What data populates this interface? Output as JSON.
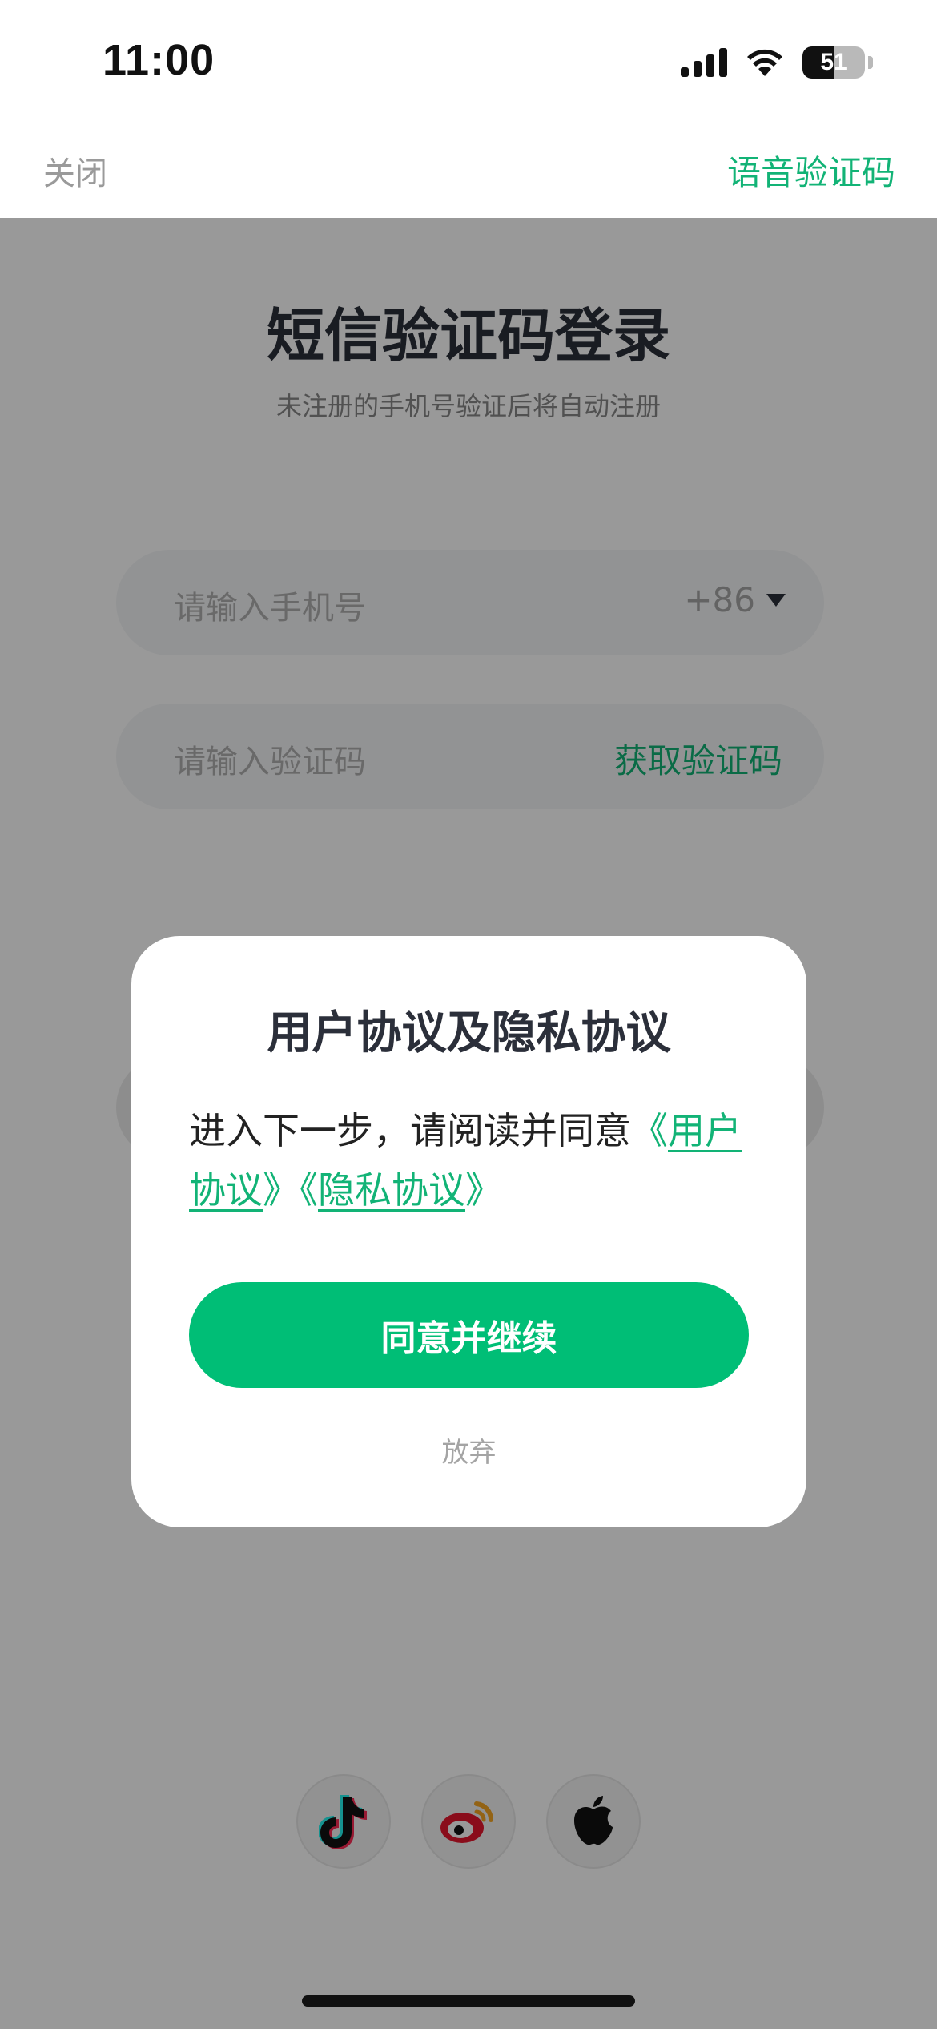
{
  "status_bar": {
    "time": "11:00",
    "battery_level": "51",
    "battery_fraction": 0.51
  },
  "nav": {
    "close_label": "关闭",
    "voice_code_label": "语音验证码"
  },
  "login": {
    "title": "短信验证码登录",
    "subtitle": "未注册的手机号验证后将自动注册",
    "phone_placeholder": "请输入手机号",
    "country_code": "+86",
    "code_placeholder": "请输入验证码",
    "get_code_label": "获取验证码"
  },
  "social": {
    "icons": [
      "tiktok-icon",
      "weibo-icon",
      "apple-icon"
    ]
  },
  "modal": {
    "title": "用户协议及隐私协议",
    "body_prefix": "进入下一步，请阅读并同意",
    "open_bracket_1": "《",
    "user_agreement": "用户协议",
    "close_open_bracket": "》《",
    "privacy_agreement": "隐私协议",
    "close_bracket_2": "》",
    "agree_label": "同意并继续",
    "giveup_label": "放弃"
  },
  "colors": {
    "accent": "#12b376",
    "button": "#00be76",
    "overlay": "rgba(0,0,0,0.40)"
  }
}
